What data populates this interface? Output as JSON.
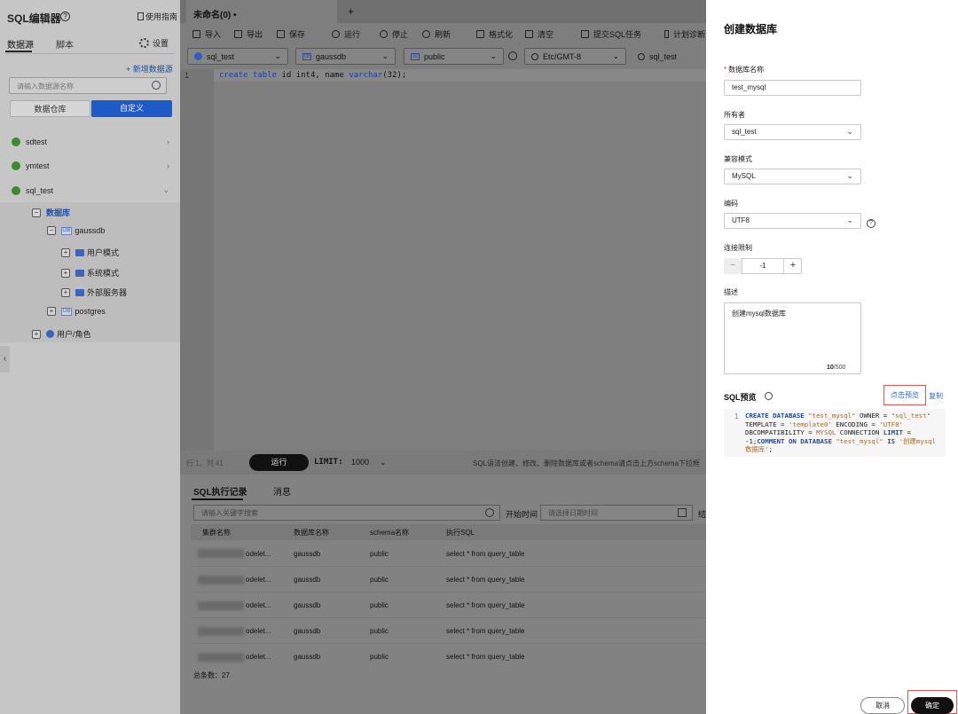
{
  "sidebar": {
    "title": "SQL编辑器",
    "guide": "使用指南",
    "tab_datasource": "数据源",
    "tab_script": "脚本",
    "settings": "设置",
    "add_datasource": "+ 新增数据源",
    "search_placeholder": "请输入数据源名称",
    "seg_warehouse": "数据仓库",
    "seg_custom": "自定义",
    "nodes": {
      "sdtest": "sdtest",
      "ymtest": "ymtest",
      "sql_test": "sql_test",
      "databases": "数据库",
      "gaussdb": "gaussdb",
      "user_mode": "用户模式",
      "system_mode": "系统模式",
      "external": "外部服务器",
      "postgres": "postgres",
      "users_roles": "用户/角色"
    }
  },
  "editor": {
    "tab_title": "未命名(0)",
    "tab_dot": "•",
    "toolbar": {
      "import": "导入",
      "export": "导出",
      "save": "保存",
      "run": "运行",
      "stop": "停止",
      "refresh": "刷新",
      "format": "格式化",
      "clear": "清空",
      "submit": "提交SQL任务",
      "plan": "计划诊断"
    },
    "selects": {
      "datasource": "sql_test",
      "database": "gaussdb",
      "schema": "public",
      "timezone": "Etc/GMT-8",
      "user": "sql_test"
    },
    "line_number": "1",
    "code": {
      "kw1": "create",
      "kw2": "table",
      "rest1": " id int4, name ",
      "kw3": "varchar",
      "rest2": "(32);"
    },
    "cursor": "行 1，列 41",
    "run_button": "运行",
    "limit_label": "LIMIT:",
    "limit_value": "1000",
    "hint": "SQL语法创建、修改、删除数据库或者schema请点击上方schema下拉框"
  },
  "history": {
    "tab_records": "SQL执行记录",
    "tab_messages": "消息",
    "search_placeholder": "请输入关键字搜索",
    "start_time_label": "开始时间",
    "date_placeholder": "请选择日期时间",
    "more_label": "结",
    "headers": [
      "集群名称",
      "数据库名称",
      "schema名称",
      "执行SQL"
    ],
    "rows": [
      {
        "cluster": "odelet...",
        "db": "gaussdb",
        "schema": "public",
        "sql": "select * from query_table"
      },
      {
        "cluster": "odelet...",
        "db": "gaussdb",
        "schema": "public",
        "sql": "select * from query_table"
      },
      {
        "cluster": "odelet...",
        "db": "gaussdb",
        "schema": "public",
        "sql": "select * from query_table"
      },
      {
        "cluster": "odelet...",
        "db": "gaussdb",
        "schema": "public",
        "sql": "select * from query_table"
      },
      {
        "cluster": "odelet...",
        "db": "gaussdb",
        "schema": "public",
        "sql": "select * from query_table"
      }
    ],
    "total": "总条数：27"
  },
  "drawer": {
    "title": "创建数据库",
    "db_name_label": "数据库名称",
    "db_name_value": "test_mysql",
    "owner_label": "所有者",
    "owner_value": "sql_test",
    "compat_label": "兼容模式",
    "compat_value": "MySQL",
    "encoding_label": "编码",
    "encoding_value": "UTF8",
    "conn_limit_label": "连接限制",
    "conn_limit_value": "-1",
    "desc_label": "描述",
    "desc_value": "创建mysql数据库",
    "desc_count": "10",
    "desc_max": "/500",
    "preview_label": "SQL预览",
    "preview_link": "点击预览",
    "copy_link": "复制",
    "sql_line": "1",
    "sql": {
      "k1": "CREATE DATABASE",
      "s1": "\"test_mysql\"",
      "t1": " OWNER = ",
      "s2": "\"sql_test\"",
      "t2": " TEMPLATE = ",
      "s3": "'template0'",
      "t3": " ENCODING = ",
      "s4": "'UTF8'",
      "t4": " DBCOMPATIBILITY = ",
      "s5": "MYSQL",
      "t5": " CONNECTION ",
      "k2": "LIMIT",
      "t6": " = -1;",
      "k3": "COMMENT ON DATABASE",
      "s6": "\"test_mysql\"",
      "k4": " IS ",
      "s7": "'创建mysql数据库'",
      "t7": ";"
    },
    "cancel": "取消",
    "confirm": "确定"
  }
}
